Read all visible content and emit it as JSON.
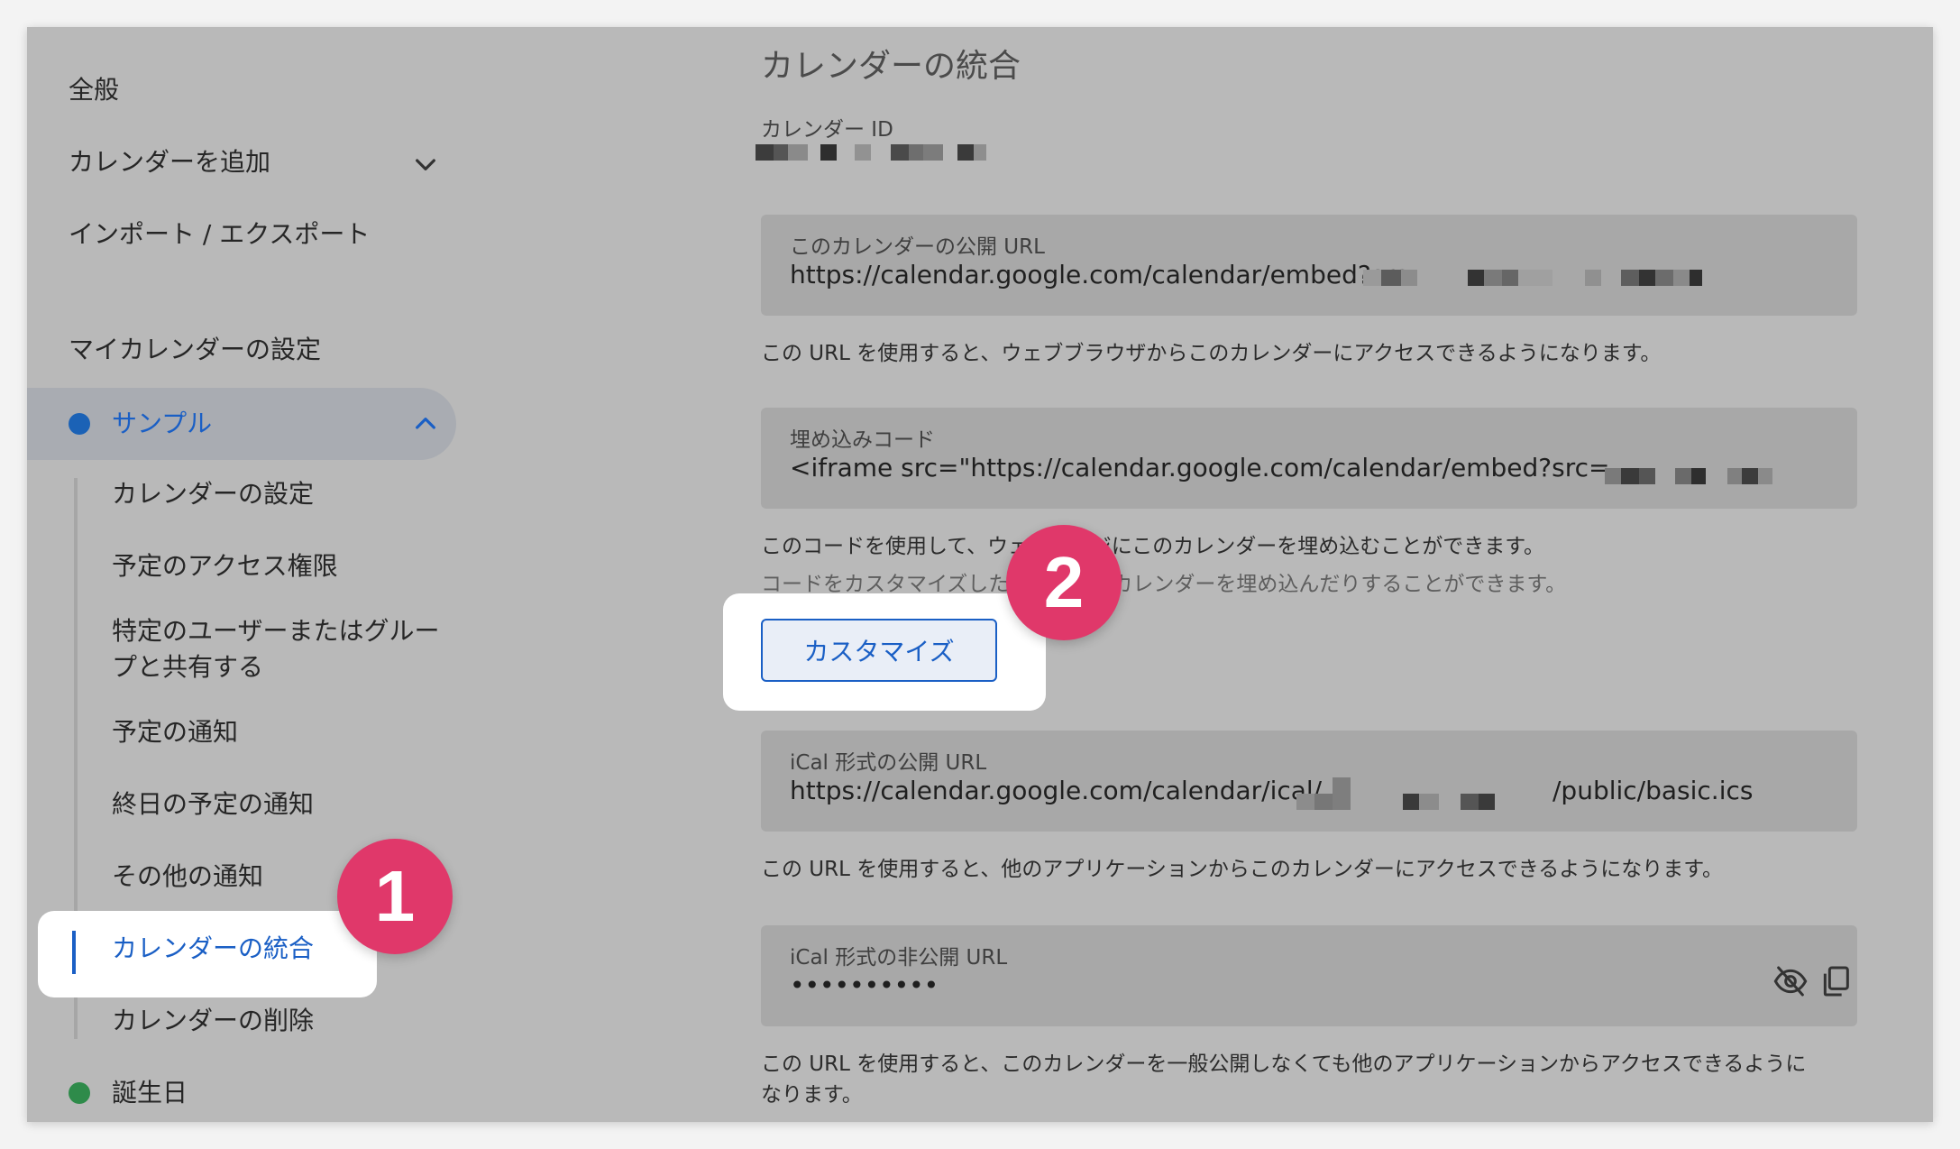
{
  "sidebar": {
    "general": "全般",
    "add_calendar": "カレンダーを追加",
    "import_export": "インポート / エクスポート",
    "my_calendars_heading": "マイカレンダーの設定",
    "active_calendar": {
      "name": "サンプル",
      "color": "#1b62b6"
    },
    "sub_items": {
      "calendar_settings": "カレンダーの設定",
      "access_permissions": "予定のアクセス権限",
      "share_line1": "特定のユーザーまたはグルー",
      "share_line2": "プと共有する",
      "event_notifications": "予定の通知",
      "allday_notifications": "終日の予定の通知",
      "other_notifications": "その他の通知",
      "integrate": "カレンダーの統合",
      "delete": "カレンダーの削除"
    },
    "other_calendar": {
      "name": "誕生日",
      "color": "#2e8b4a"
    }
  },
  "main": {
    "title": "カレンダーの統合",
    "calendar_id_label": "カレンダー ID",
    "public_url": {
      "label": "このカレンダーの公開 URL",
      "value": "https://calendar.google.com/calendar/embed?src=",
      "description": "この URL を使用すると、ウェブブラウザからこのカレンダーにアクセスできるようになります。"
    },
    "embed_code": {
      "label": "埋め込みコード",
      "value": "<iframe src=\"https://calendar.google.com/calendar/embed?src=",
      "description_line1": "このコードを使用して、ウェブページにこのカレンダーを埋め込むことができます。",
      "description_line2": "コードをカスタマイズしたり、複数のカレンダーを埋め込んだりすることができます。"
    },
    "customize_button": "カスタマイズ",
    "ical_public": {
      "label": "iCal 形式の公開 URL",
      "value_prefix": "https://calendar.google.com/calendar/ical/",
      "value_suffix": "/public/basic.ics",
      "description": "この URL を使用すると、他のアプリケーションからこのカレンダーにアクセスできるようになります。"
    },
    "ical_private": {
      "label": "iCal 形式の非公開 URL",
      "value": "••••••••••",
      "visibility_icon": "eye-off-icon",
      "copy_icon": "copy-icon",
      "description_line1": "この URL を使用すると、このカレンダーを一般公開しなくても他のアプリケーションからアクセスできるように",
      "description_line2": "なります。"
    }
  },
  "annotations": {
    "step1": "1",
    "step2": "2",
    "badge_color": "#e0386a"
  },
  "colors": {
    "accent": "#1a5fc5"
  }
}
